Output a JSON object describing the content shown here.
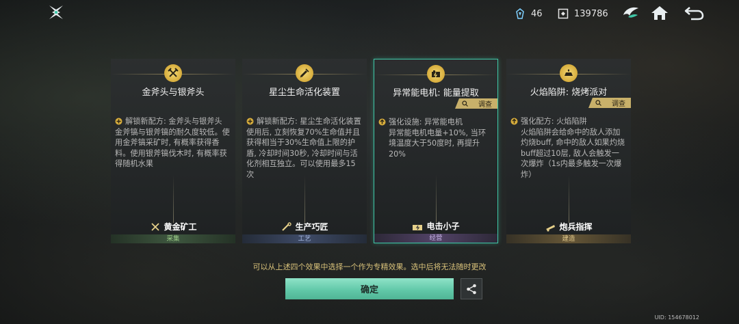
{
  "resources": {
    "gems": "46",
    "coins": "139786"
  },
  "cards": [
    {
      "title": "金斧头与银斧头",
      "survey": "",
      "lead": "解锁新配方: 金斧头与银斧头",
      "body": "金斧镐与银斧镐的耐久度较低。使用金斧镐采矿时, 有概率获得香料。使用银斧镐伐木时, 有概率获得随机水果",
      "role": "黄金矿工",
      "category": "采集"
    },
    {
      "title": "星尘生命活化装置",
      "survey": "",
      "lead": "解锁新配方: 星尘生命活化装置",
      "body": "使用后, 立刻恢复70%生命值并且获得相当于30%生命值上限的护盾, 冷却时间30秒, 冷却时间与活化剂相互独立。可以使用最多15次",
      "role": "生产巧匠",
      "category": "工艺"
    },
    {
      "title": "异常能电机: 能量提取",
      "survey": "调查",
      "lead": "强化设施: 异常能电机",
      "body": "异常能电机电量+10%, 当环境温度大于50度时, 再提升20%",
      "role": "电击小子",
      "category": "经营"
    },
    {
      "title": "火焰陷阱: 烧烤派对",
      "survey": "调查",
      "lead": "强化配方: 火焰陷阱",
      "body": "火焰陷阱会给命中的敌人添加灼烧buff, 命中的敌人如果灼烧buff超过10层, 敌人会触发一次爆炸（1s内最多触发一次爆炸）",
      "role": "炮兵指挥",
      "category": "建造"
    }
  ],
  "hint": "可以从上述四个效果中选择一个作为专精效果。选中后将无法随时更改",
  "confirm_label": "确定",
  "uid": "UID: 154678012",
  "colors": {
    "accent": "#3fc7a7",
    "gold": "#d9c27a",
    "confirm": "#62c9a9"
  }
}
